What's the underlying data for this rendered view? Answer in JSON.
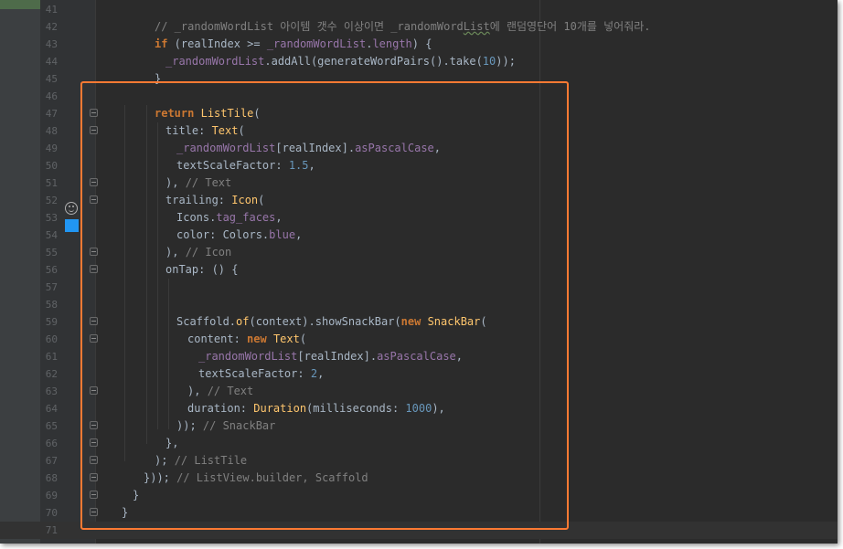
{
  "editor": {
    "colors": {
      "background": "#2b2b2b",
      "keyword": "#cc7832",
      "function": "#ffc66d",
      "field": "#9876aa",
      "number": "#6897bb",
      "comment": "#808080",
      "highlight_border": "#ff7a33",
      "color_swatch": "#2196f3"
    },
    "gutter_icons": [
      {
        "line": 53,
        "icon": "smiley-face-icon"
      },
      {
        "line": 54,
        "icon": "blue-color-swatch-icon"
      }
    ],
    "lines": [
      {
        "n": "41",
        "indent": 0,
        "segments": []
      },
      {
        "n": "42",
        "indent": 12,
        "segments": [
          {
            "t": "// _randomWordList 아이템 갯수 이상이면 _randomWord",
            "c": "c"
          },
          {
            "t": "List",
            "c": "c"
          },
          {
            "t": "에 랜덤영단어 10개를 넣어줘라.",
            "c": "c"
          }
        ]
      },
      {
        "n": "43",
        "indent": 12,
        "segments": [
          {
            "t": "if",
            "c": "k"
          },
          {
            "t": " (realIndex >= ",
            "c": "p"
          },
          {
            "t": "_randomWordList",
            "c": "v"
          },
          {
            "t": ".",
            "c": "p"
          },
          {
            "t": "length",
            "c": "v"
          },
          {
            "t": ") {",
            "c": "p"
          }
        ]
      },
      {
        "n": "44",
        "indent": 13,
        "segments": [
          {
            "t": "_randomWordList",
            "c": "v"
          },
          {
            "t": ".addAll(generateWordPairs().take(",
            "c": "p"
          },
          {
            "t": "10",
            "c": "n"
          },
          {
            "t": "));",
            "c": "p"
          }
        ]
      },
      {
        "n": "45",
        "indent": 12,
        "segments": [
          {
            "t": "}",
            "c": "p"
          }
        ]
      },
      {
        "n": "46",
        "indent": 0,
        "segments": []
      },
      {
        "n": "47",
        "indent": 12,
        "segments": [
          {
            "t": "return",
            "c": "k"
          },
          {
            "t": " ",
            "c": "p"
          },
          {
            "t": "ListTile",
            "c": "f"
          },
          {
            "t": "(",
            "c": "p"
          }
        ]
      },
      {
        "n": "48",
        "indent": 13,
        "segments": [
          {
            "t": "title: ",
            "c": "p"
          },
          {
            "t": "Text",
            "c": "f"
          },
          {
            "t": "(",
            "c": "p"
          }
        ]
      },
      {
        "n": "49",
        "indent": 14,
        "segments": [
          {
            "t": "_randomWordList",
            "c": "v"
          },
          {
            "t": "[realIndex].",
            "c": "p"
          },
          {
            "t": "asPascalCase",
            "c": "v"
          },
          {
            "t": ",",
            "c": "p"
          }
        ]
      },
      {
        "n": "50",
        "indent": 14,
        "segments": [
          {
            "t": "textScaleFactor: ",
            "c": "p"
          },
          {
            "t": "1.5",
            "c": "n"
          },
          {
            "t": ",",
            "c": "p"
          }
        ]
      },
      {
        "n": "51",
        "indent": 13,
        "segments": [
          {
            "t": "), ",
            "c": "p"
          },
          {
            "t": "// Text",
            "c": "c"
          }
        ]
      },
      {
        "n": "52",
        "indent": 13,
        "segments": [
          {
            "t": "trailing: ",
            "c": "p"
          },
          {
            "t": "Icon",
            "c": "f"
          },
          {
            "t": "(",
            "c": "p"
          }
        ]
      },
      {
        "n": "53",
        "indent": 14,
        "segments": [
          {
            "t": "Icons.",
            "c": "p"
          },
          {
            "t": "tag_faces",
            "c": "v"
          },
          {
            "t": ",",
            "c": "p"
          }
        ]
      },
      {
        "n": "54",
        "indent": 14,
        "segments": [
          {
            "t": "color: Colors.",
            "c": "p"
          },
          {
            "t": "blue",
            "c": "v"
          },
          {
            "t": ",",
            "c": "p"
          }
        ]
      },
      {
        "n": "55",
        "indent": 13,
        "segments": [
          {
            "t": "), ",
            "c": "p"
          },
          {
            "t": "// Icon",
            "c": "c"
          }
        ]
      },
      {
        "n": "56",
        "indent": 13,
        "segments": [
          {
            "t": "onTap: () {",
            "c": "p"
          }
        ]
      },
      {
        "n": "57",
        "indent": 0,
        "segments": []
      },
      {
        "n": "58",
        "indent": 0,
        "segments": []
      },
      {
        "n": "59",
        "indent": 14,
        "segments": [
          {
            "t": "Scaffold.",
            "c": "p"
          },
          {
            "t": "of",
            "c": "f"
          },
          {
            "t": "(context).showSnackBar(",
            "c": "p"
          },
          {
            "t": "new",
            "c": "k"
          },
          {
            "t": " ",
            "c": "p"
          },
          {
            "t": "SnackBar",
            "c": "f"
          },
          {
            "t": "(",
            "c": "p"
          }
        ]
      },
      {
        "n": "60",
        "indent": 15,
        "segments": [
          {
            "t": "content: ",
            "c": "p"
          },
          {
            "t": "new",
            "c": "k"
          },
          {
            "t": " ",
            "c": "p"
          },
          {
            "t": "Text",
            "c": "f"
          },
          {
            "t": "(",
            "c": "p"
          }
        ]
      },
      {
        "n": "61",
        "indent": 16,
        "segments": [
          {
            "t": "_randomWordList",
            "c": "v"
          },
          {
            "t": "[realIndex].",
            "c": "p"
          },
          {
            "t": "asPascalCase",
            "c": "v"
          },
          {
            "t": ",",
            "c": "p"
          }
        ]
      },
      {
        "n": "62",
        "indent": 16,
        "segments": [
          {
            "t": "textScaleFactor: ",
            "c": "p"
          },
          {
            "t": "2",
            "c": "n"
          },
          {
            "t": ",",
            "c": "p"
          }
        ]
      },
      {
        "n": "63",
        "indent": 15,
        "segments": [
          {
            "t": "), ",
            "c": "p"
          },
          {
            "t": "// Text",
            "c": "c"
          }
        ]
      },
      {
        "n": "64",
        "indent": 15,
        "segments": [
          {
            "t": "duration: ",
            "c": "p"
          },
          {
            "t": "Duration",
            "c": "f"
          },
          {
            "t": "(milliseconds: ",
            "c": "p"
          },
          {
            "t": "1000",
            "c": "n"
          },
          {
            "t": "),",
            "c": "p"
          }
        ]
      },
      {
        "n": "65",
        "indent": 14,
        "segments": [
          {
            "t": ")); ",
            "c": "p"
          },
          {
            "t": "// SnackBar",
            "c": "c"
          }
        ]
      },
      {
        "n": "66",
        "indent": 13,
        "segments": [
          {
            "t": "},",
            "c": "p"
          }
        ]
      },
      {
        "n": "67",
        "indent": 12,
        "segments": [
          {
            "t": "); ",
            "c": "p"
          },
          {
            "t": "// ListTile",
            "c": "c"
          }
        ]
      },
      {
        "n": "68",
        "indent": 11,
        "segments": [
          {
            "t": "})); ",
            "c": "p"
          },
          {
            "t": "// ListView.builder, Scaffold",
            "c": "c"
          }
        ]
      },
      {
        "n": "69",
        "indent": 10,
        "segments": [
          {
            "t": "}",
            "c": "p"
          }
        ]
      },
      {
        "n": "70",
        "indent": 9,
        "segments": [
          {
            "t": "}",
            "c": "p"
          }
        ]
      },
      {
        "n": "71",
        "indent": 0,
        "segments": [],
        "current": true
      }
    ]
  }
}
